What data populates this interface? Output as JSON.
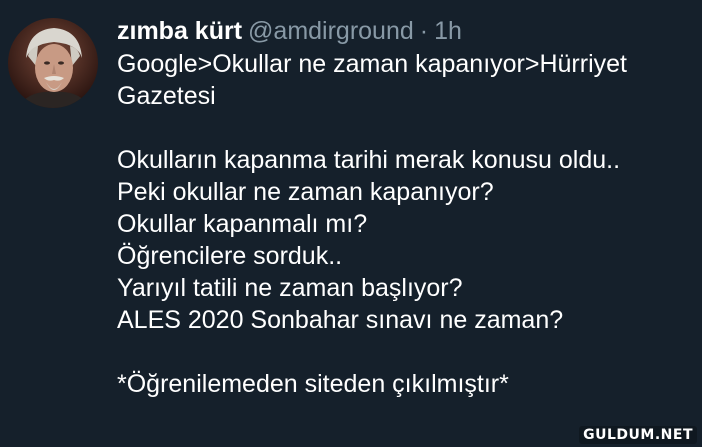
{
  "tweet": {
    "author": {
      "name": "zımba kürt",
      "handle": "@amdirground",
      "separator": "·",
      "time": "1h"
    },
    "lines": [
      "Google>Okullar ne zaman kapanıyor>Hürriyet",
      "Gazetesi",
      "",
      "Okulların kapanma tarihi merak konusu oldu..",
      "Peki okullar ne zaman kapanıyor?",
      "Okullar kapanmalı mı?",
      "Öğrencilere sorduk..",
      "Yarıyıl tatili ne zaman başlıyor?",
      "ALES 2020 Sonbahar sınavı ne zaman?",
      "",
      "*Öğrenilemeden siteden çıkılmıştır*"
    ]
  },
  "watermark": "GULDUM.NET",
  "colors": {
    "background": "#15202b",
    "text": "#ffffff",
    "secondary": "#8899a6"
  }
}
